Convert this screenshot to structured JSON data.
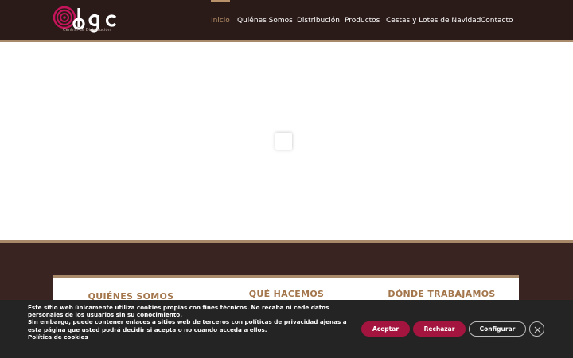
{
  "header": {
    "logo_sub": "Central de Distribución",
    "nav": [
      {
        "label": "Inicio",
        "active": true
      },
      {
        "label": "Quiénes Somos"
      },
      {
        "label": "Distribución"
      },
      {
        "label": "Productos"
      },
      {
        "label": "Cestas y Lotes de Navidad"
      },
      {
        "label": "Contacto"
      }
    ]
  },
  "cards": [
    {
      "title": "QUIÉNES SOMOS"
    },
    {
      "title": "QUÉ HACEMOS"
    },
    {
      "title": "DÓNDE TRABAJAMOS"
    }
  ],
  "cookies": {
    "line1": "Este sitio web únicamente utiliza cookies propias con fines técnicos. No recaba ni cede datos personales de los usuarios sin su conocimiento.",
    "line2": "Sin embargo, puede contener enlaces a sitios web de terceros con políticas de privacidad ajenas a esta página que usted podrá decidir si acepta o no cuando acceda a ellos.",
    "policy_link": "Política de cookies",
    "accept": "Aceptar",
    "reject": "Rechazar",
    "configure": "Configurar"
  },
  "colors": {
    "header_bg": "#2a1a18",
    "accent_gold": "#b8916a",
    "section_bg": "#3a2422",
    "card_title": "#a3764c",
    "button_crimson": "#a3153f",
    "logo_magenta": "#c4145a"
  },
  "icons": [
    "logo-spiral-icon",
    "close-icon"
  ]
}
